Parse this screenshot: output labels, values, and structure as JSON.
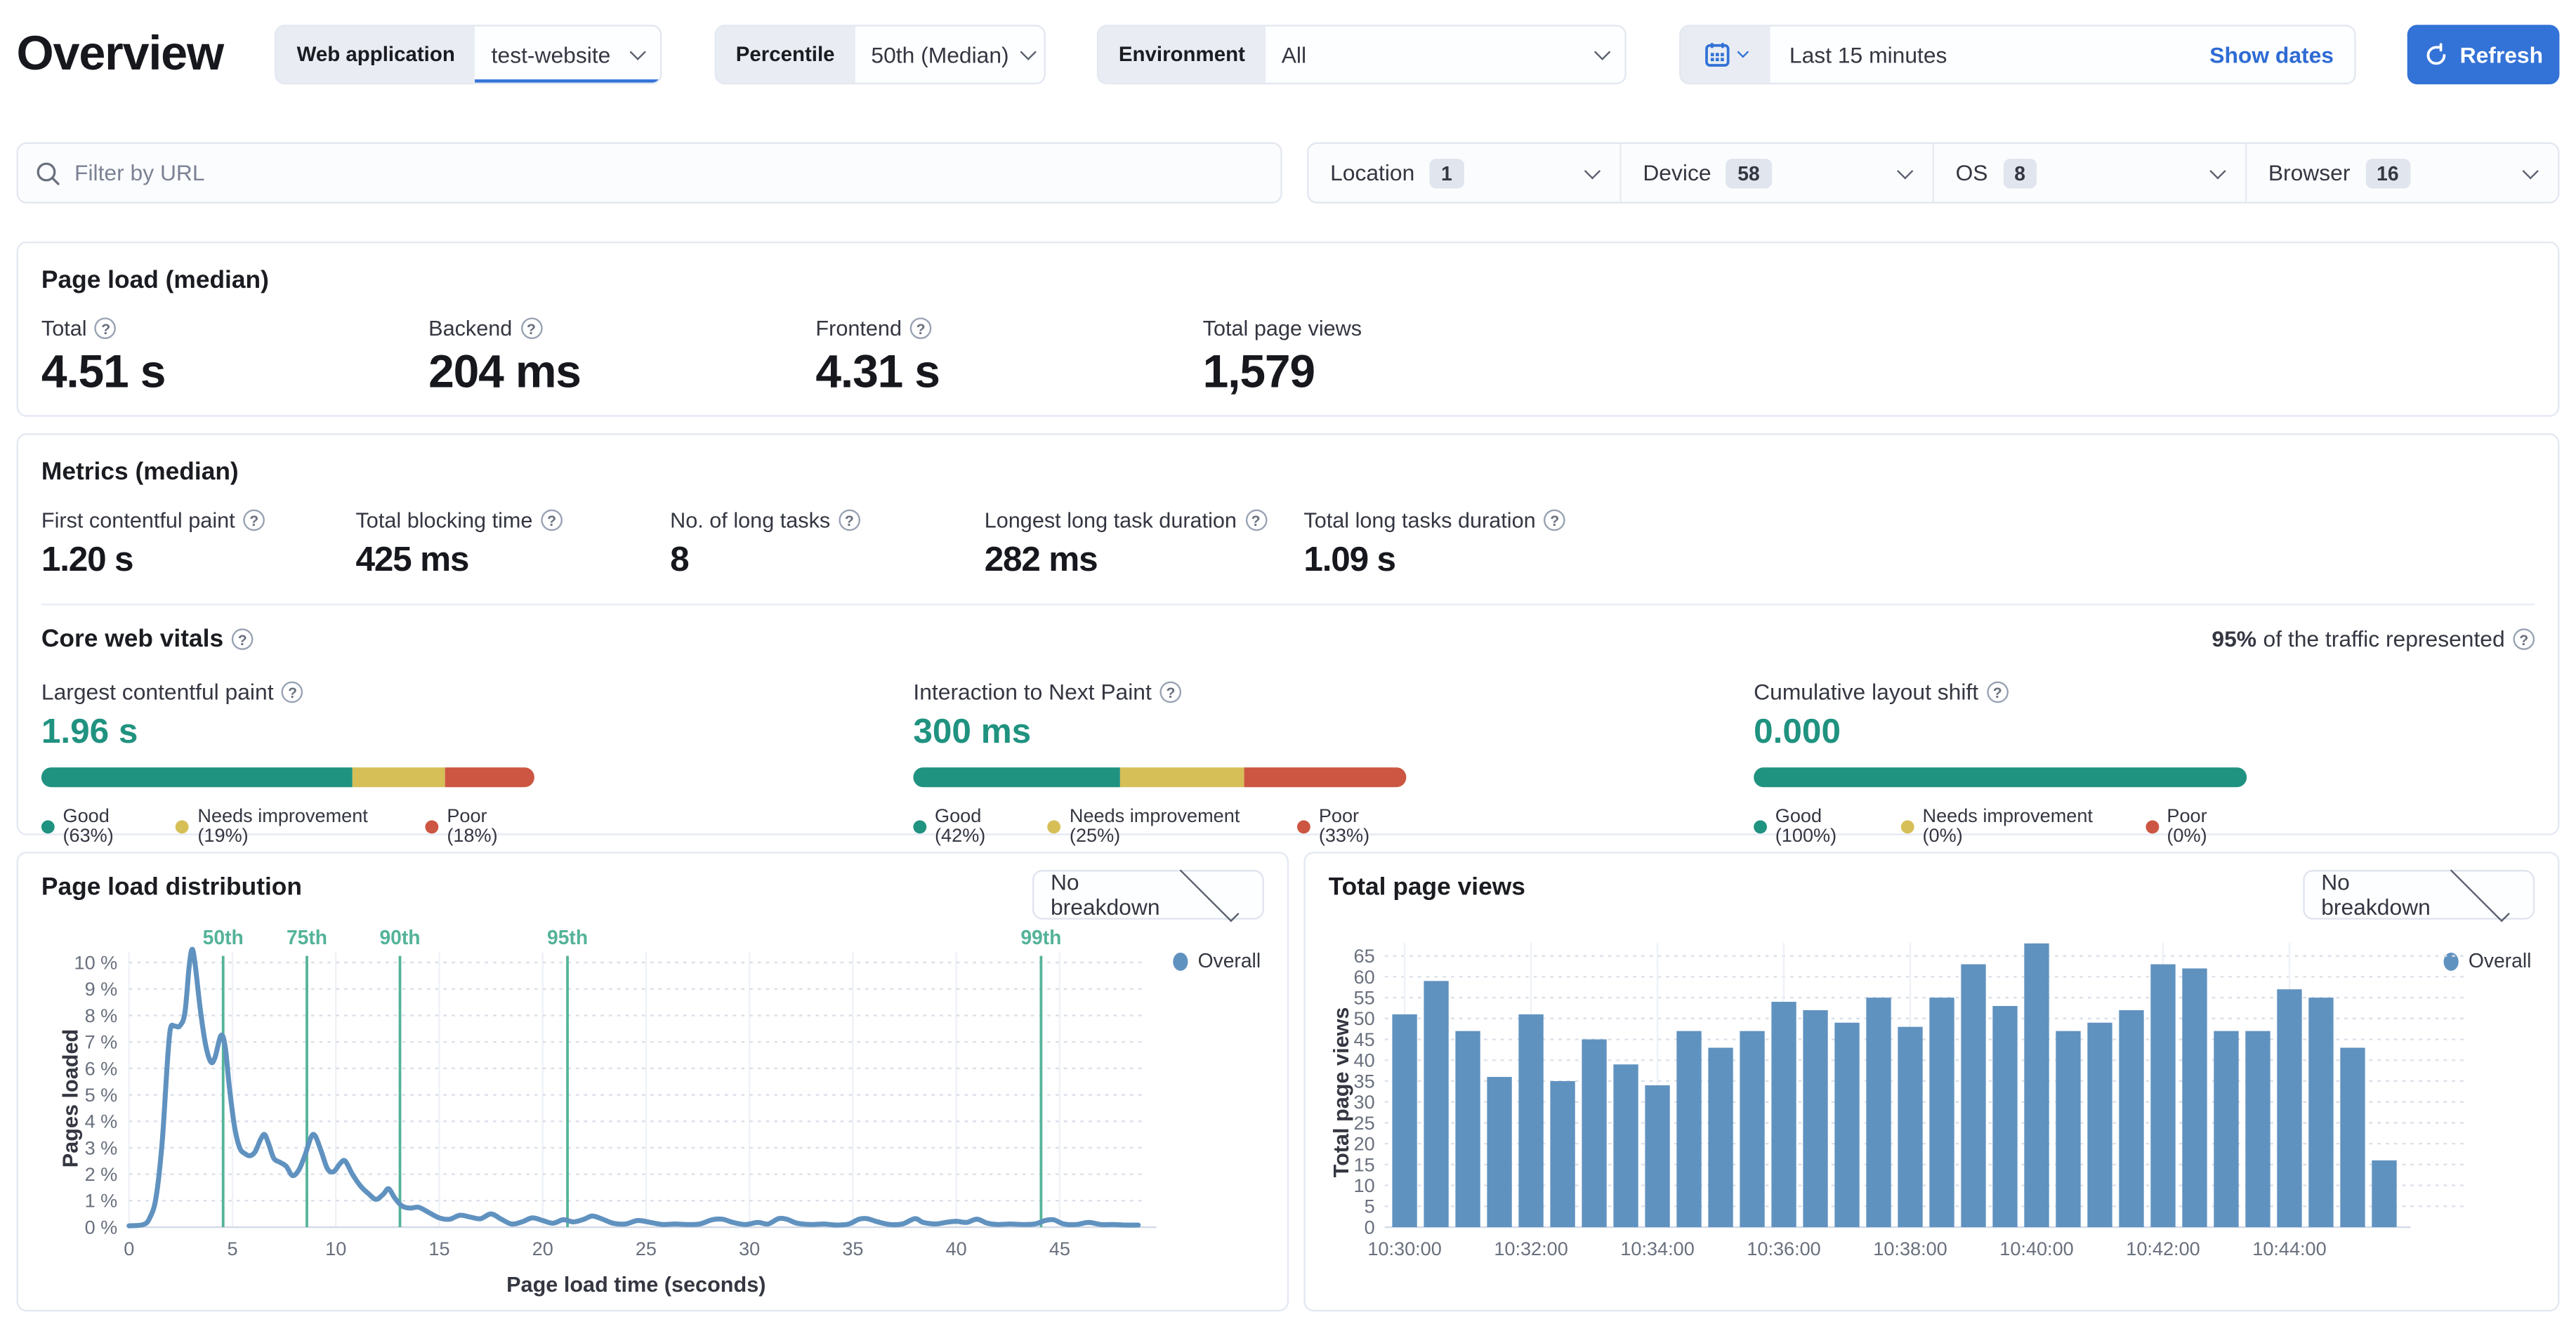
{
  "header": {
    "title": "Overview",
    "web_application": {
      "label": "Web application",
      "value": "test-website"
    },
    "percentile": {
      "label": "Percentile",
      "value": "50th (Median)"
    },
    "environment": {
      "label": "Environment",
      "value": "All"
    },
    "time_picker": {
      "value": "Last 15 minutes",
      "show_dates_label": "Show dates"
    },
    "refresh_label": "Refresh"
  },
  "filter_bar": {
    "search_placeholder": "Filter by URL",
    "filters": [
      {
        "label": "Location",
        "count": "1"
      },
      {
        "label": "Device",
        "count": "58"
      },
      {
        "label": "OS",
        "count": "8"
      },
      {
        "label": "Browser",
        "count": "16"
      }
    ]
  },
  "page_load_panel": {
    "title": "Page load (median)",
    "stats": [
      {
        "label": "Total",
        "value": "4.51 s"
      },
      {
        "label": "Backend",
        "value": "204 ms"
      },
      {
        "label": "Frontend",
        "value": "4.31 s"
      },
      {
        "label": "Total page views",
        "value": "1,579"
      }
    ]
  },
  "metrics_panel": {
    "title": "Metrics (median)",
    "stats": [
      {
        "label": "First contentful paint",
        "value": "1.20 s"
      },
      {
        "label": "Total blocking time",
        "value": "425 ms"
      },
      {
        "label": "No. of long tasks",
        "value": "8"
      },
      {
        "label": "Longest long task duration",
        "value": "282 ms"
      },
      {
        "label": "Total long tasks duration",
        "value": "1.09 s"
      }
    ],
    "core_web_vitals": {
      "title": "Core web vitals",
      "traffic_note_strong": "95%",
      "traffic_note": "of the traffic represented",
      "vitals": [
        {
          "label": "Largest contentful paint",
          "value": "1.96 s",
          "good": 63,
          "needs_improvement": 19,
          "poor": 18,
          "legend": [
            "Good (63%)",
            "Needs improvement (19%)",
            "Poor (18%)"
          ]
        },
        {
          "label": "Interaction to Next Paint",
          "value": "300 ms",
          "good": 42,
          "needs_improvement": 25,
          "poor": 33,
          "legend": [
            "Good (42%)",
            "Needs improvement (25%)",
            "Poor (33%)"
          ]
        },
        {
          "label": "Cumulative layout shift",
          "value": "0.000",
          "good": 100,
          "needs_improvement": 0,
          "poor": 0,
          "legend": [
            "Good (100%)",
            "Needs improvement (0%)",
            "Poor (0%)"
          ]
        }
      ]
    }
  },
  "charts": {
    "distribution": {
      "title": "Page load distribution",
      "breakdown_value": "No breakdown",
      "legend": "Overall",
      "xlabel": "Page load time (seconds)",
      "ylabel": "Pages loaded"
    },
    "page_views": {
      "title": "Total page views",
      "breakdown_value": "No breakdown",
      "legend": "Overall",
      "ylabel": "Total page views"
    }
  },
  "chart_data": [
    {
      "type": "line",
      "title": "Page load distribution",
      "xlabel": "Page load time (seconds)",
      "ylabel": "Pages loaded",
      "legend_position": "top-right",
      "grid": true,
      "xlim": [
        0,
        49
      ],
      "ylim": [
        0,
        11
      ],
      "x_ticks": [
        0,
        5,
        10,
        15,
        20,
        25,
        30,
        35,
        40,
        45
      ],
      "y_ticks": [
        0,
        1,
        2,
        3,
        4,
        5,
        6,
        7,
        8,
        9,
        10
      ],
      "y_tick_suffix": " %",
      "percentile_markers": [
        {
          "label": "50th",
          "x": 4.55
        },
        {
          "label": "75th",
          "x": 8.6
        },
        {
          "label": "90th",
          "x": 13.1
        },
        {
          "label": "95th",
          "x": 21.2
        },
        {
          "label": "99th",
          "x": 44.1
        }
      ],
      "series": [
        {
          "name": "Overall",
          "points": [
            [
              0,
              0.05
            ],
            [
              0.7,
              0.1
            ],
            [
              1.0,
              0.35
            ],
            [
              1.3,
              1.1
            ],
            [
              1.6,
              3.2
            ],
            [
              1.85,
              6.2
            ],
            [
              2.0,
              7.5
            ],
            [
              2.2,
              7.6
            ],
            [
              2.45,
              7.6
            ],
            [
              2.7,
              8.1
            ],
            [
              2.9,
              9.8
            ],
            [
              3.05,
              10.5
            ],
            [
              3.2,
              9.9
            ],
            [
              3.45,
              8.2
            ],
            [
              3.7,
              6.9
            ],
            [
              3.95,
              6.25
            ],
            [
              4.15,
              6.4
            ],
            [
              4.45,
              7.25
            ],
            [
              4.65,
              6.8
            ],
            [
              4.85,
              5.3
            ],
            [
              5.1,
              3.8
            ],
            [
              5.35,
              3.0
            ],
            [
              5.6,
              2.78
            ],
            [
              5.85,
              2.7
            ],
            [
              6.1,
              2.85
            ],
            [
              6.35,
              3.3
            ],
            [
              6.55,
              3.5
            ],
            [
              6.75,
              3.15
            ],
            [
              7.0,
              2.6
            ],
            [
              7.3,
              2.45
            ],
            [
              7.6,
              2.3
            ],
            [
              7.9,
              1.95
            ],
            [
              8.2,
              2.15
            ],
            [
              8.5,
              2.7
            ],
            [
              8.8,
              3.4
            ],
            [
              9.0,
              3.45
            ],
            [
              9.3,
              2.85
            ],
            [
              9.6,
              2.2
            ],
            [
              9.9,
              2.1
            ],
            [
              10.2,
              2.4
            ],
            [
              10.45,
              2.5
            ],
            [
              10.8,
              2.0
            ],
            [
              11.2,
              1.55
            ],
            [
              11.6,
              1.25
            ],
            [
              11.95,
              1.05
            ],
            [
              12.3,
              1.25
            ],
            [
              12.55,
              1.45
            ],
            [
              12.85,
              1.1
            ],
            [
              13.2,
              0.8
            ],
            [
              13.6,
              0.72
            ],
            [
              14.0,
              0.75
            ],
            [
              14.5,
              0.55
            ],
            [
              15.0,
              0.35
            ],
            [
              15.5,
              0.3
            ],
            [
              16.0,
              0.45
            ],
            [
              16.5,
              0.38
            ],
            [
              17.0,
              0.32
            ],
            [
              17.5,
              0.5
            ],
            [
              18.0,
              0.3
            ],
            [
              18.5,
              0.12
            ],
            [
              19.0,
              0.2
            ],
            [
              19.5,
              0.35
            ],
            [
              20.0,
              0.25
            ],
            [
              20.5,
              0.15
            ],
            [
              21.0,
              0.28
            ],
            [
              21.5,
              0.2
            ],
            [
              22.0,
              0.3
            ],
            [
              22.4,
              0.42
            ],
            [
              22.9,
              0.3
            ],
            [
              23.4,
              0.15
            ],
            [
              24.0,
              0.12
            ],
            [
              24.6,
              0.25
            ],
            [
              25.2,
              0.18
            ],
            [
              25.8,
              0.1
            ],
            [
              26.4,
              0.12
            ],
            [
              27.0,
              0.1
            ],
            [
              27.6,
              0.12
            ],
            [
              28.2,
              0.28
            ],
            [
              28.7,
              0.3
            ],
            [
              29.2,
              0.18
            ],
            [
              29.8,
              0.1
            ],
            [
              30.4,
              0.18
            ],
            [
              30.9,
              0.12
            ],
            [
              31.4,
              0.32
            ],
            [
              31.8,
              0.3
            ],
            [
              32.3,
              0.15
            ],
            [
              33.0,
              0.1
            ],
            [
              33.6,
              0.12
            ],
            [
              34.2,
              0.08
            ],
            [
              34.8,
              0.12
            ],
            [
              35.3,
              0.3
            ],
            [
              35.7,
              0.32
            ],
            [
              36.2,
              0.2
            ],
            [
              36.8,
              0.1
            ],
            [
              37.4,
              0.12
            ],
            [
              38.0,
              0.32
            ],
            [
              38.4,
              0.18
            ],
            [
              39.0,
              0.12
            ],
            [
              39.5,
              0.18
            ],
            [
              40.0,
              0.22
            ],
            [
              40.5,
              0.18
            ],
            [
              41.0,
              0.3
            ],
            [
              41.5,
              0.15
            ],
            [
              42.0,
              0.1
            ],
            [
              42.6,
              0.12
            ],
            [
              43.2,
              0.1
            ],
            [
              43.8,
              0.12
            ],
            [
              44.3,
              0.25
            ],
            [
              44.7,
              0.28
            ],
            [
              45.2,
              0.12
            ],
            [
              45.8,
              0.1
            ],
            [
              46.4,
              0.18
            ],
            [
              47.0,
              0.1
            ],
            [
              47.6,
              0.1
            ],
            [
              48.2,
              0.08
            ],
            [
              48.8,
              0.08
            ]
          ]
        }
      ]
    },
    {
      "type": "bar",
      "title": "Total page views",
      "xlabel": "",
      "ylabel": "Total page views",
      "legend_position": "top-right",
      "grid": true,
      "ylim": [
        0,
        70
      ],
      "y_ticks": [
        0,
        5,
        10,
        15,
        20,
        25,
        30,
        35,
        40,
        45,
        50,
        55,
        60,
        65
      ],
      "x_tick_every": 4,
      "categories": [
        "10:30:00",
        "10:30:30",
        "10:31:00",
        "10:31:30",
        "10:32:00",
        "10:32:30",
        "10:33:00",
        "10:33:30",
        "10:34:00",
        "10:34:30",
        "10:35:00",
        "10:35:30",
        "10:36:00",
        "10:36:30",
        "10:37:00",
        "10:37:30",
        "10:38:00",
        "10:38:30",
        "10:39:00",
        "10:39:30",
        "10:40:00",
        "10:40:30",
        "10:41:00",
        "10:41:30",
        "10:42:00",
        "10:42:30",
        "10:43:00",
        "10:43:30",
        "10:44:00",
        "10:44:30",
        "10:45:00",
        "10:45:30"
      ],
      "series": [
        {
          "name": "Overall",
          "values": [
            51,
            59,
            47,
            36,
            51,
            35,
            45,
            39,
            34,
            47,
            43,
            47,
            54,
            52,
            49,
            55,
            48,
            55,
            63,
            53,
            68,
            47,
            49,
            52,
            63,
            62,
            47,
            47,
            57,
            55,
            43,
            16
          ]
        }
      ]
    }
  ],
  "colors": {
    "accent_blue": "#3372d6",
    "series_blue": "#6092c0",
    "good": "#209280",
    "needs_improvement": "#d6bf57",
    "poor": "#cc5642",
    "percentile": "#54b399"
  }
}
